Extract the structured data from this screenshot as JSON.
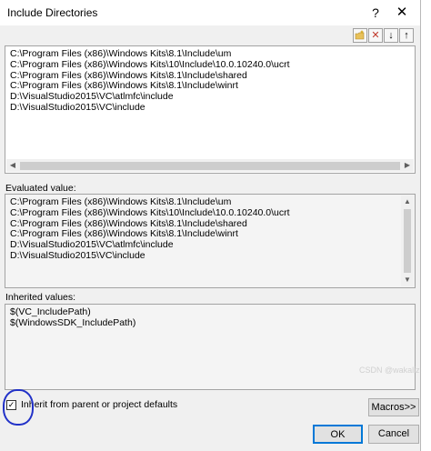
{
  "window": {
    "title": "Include Directories",
    "help_glyph": "?",
    "close_glyph": "✕"
  },
  "toolbar": {
    "new_line_icon": "new-folder-icon",
    "delete_glyph": "✕",
    "down_glyph": "↓",
    "up_glyph": "↑",
    "delete_color": "#c0392b"
  },
  "include_list": [
    "C:\\Program Files (x86)\\Windows Kits\\8.1\\Include\\um",
    "C:\\Program Files (x86)\\Windows Kits\\10\\Include\\10.0.10240.0\\ucrt",
    "C:\\Program Files (x86)\\Windows Kits\\8.1\\Include\\shared",
    "C:\\Program Files (x86)\\Windows Kits\\8.1\\Include\\winrt",
    "D:\\VisualStudio2015\\VC\\atlmfc\\include",
    "D:\\VisualStudio2015\\VC\\include"
  ],
  "evaluated": {
    "label": "Evaluated value:",
    "values": [
      "C:\\Program Files (x86)\\Windows Kits\\8.1\\Include\\um",
      "C:\\Program Files (x86)\\Windows Kits\\10\\Include\\10.0.10240.0\\ucrt",
      "C:\\Program Files (x86)\\Windows Kits\\8.1\\Include\\shared",
      "C:\\Program Files (x86)\\Windows Kits\\8.1\\Include\\winrt",
      "D:\\VisualStudio2015\\VC\\atlmfc\\include",
      "D:\\VisualStudio2015\\VC\\include"
    ]
  },
  "inherited": {
    "label": "Inherited values:",
    "values": [
      "$(VC_IncludePath)",
      "$(WindowsSDK_IncludePath)"
    ]
  },
  "inherit_checkbox": {
    "label": "Inherit from parent or project defaults",
    "checked": true,
    "check_glyph": "✓"
  },
  "buttons": {
    "macros": "Macros>>",
    "ok": "OK",
    "cancel": "Cancel"
  },
  "scroll_glyphs": {
    "left": "◀",
    "right": "▶",
    "up": "▲",
    "down": "▼"
  },
  "watermark": "CSDN @wakaliz",
  "colors": {
    "accent": "#0078d7",
    "annotation": "#2232c8"
  }
}
